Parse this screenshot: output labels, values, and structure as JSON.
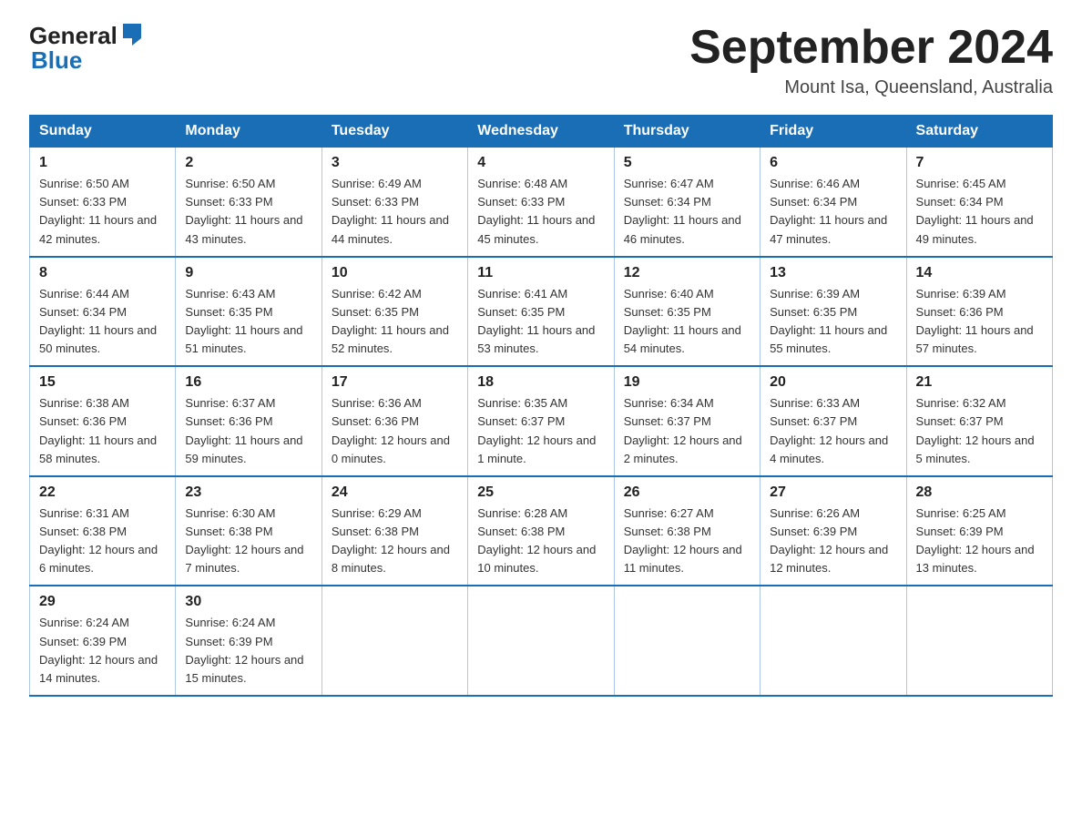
{
  "logo": {
    "general": "General",
    "blue": "Blue"
  },
  "title": "September 2024",
  "subtitle": "Mount Isa, Queensland, Australia",
  "headers": [
    "Sunday",
    "Monday",
    "Tuesday",
    "Wednesday",
    "Thursday",
    "Friday",
    "Saturday"
  ],
  "weeks": [
    [
      {
        "day": "1",
        "sunrise": "6:50 AM",
        "sunset": "6:33 PM",
        "daylight": "11 hours and 42 minutes."
      },
      {
        "day": "2",
        "sunrise": "6:50 AM",
        "sunset": "6:33 PM",
        "daylight": "11 hours and 43 minutes."
      },
      {
        "day": "3",
        "sunrise": "6:49 AM",
        "sunset": "6:33 PM",
        "daylight": "11 hours and 44 minutes."
      },
      {
        "day": "4",
        "sunrise": "6:48 AM",
        "sunset": "6:33 PM",
        "daylight": "11 hours and 45 minutes."
      },
      {
        "day": "5",
        "sunrise": "6:47 AM",
        "sunset": "6:34 PM",
        "daylight": "11 hours and 46 minutes."
      },
      {
        "day": "6",
        "sunrise": "6:46 AM",
        "sunset": "6:34 PM",
        "daylight": "11 hours and 47 minutes."
      },
      {
        "day": "7",
        "sunrise": "6:45 AM",
        "sunset": "6:34 PM",
        "daylight": "11 hours and 49 minutes."
      }
    ],
    [
      {
        "day": "8",
        "sunrise": "6:44 AM",
        "sunset": "6:34 PM",
        "daylight": "11 hours and 50 minutes."
      },
      {
        "day": "9",
        "sunrise": "6:43 AM",
        "sunset": "6:35 PM",
        "daylight": "11 hours and 51 minutes."
      },
      {
        "day": "10",
        "sunrise": "6:42 AM",
        "sunset": "6:35 PM",
        "daylight": "11 hours and 52 minutes."
      },
      {
        "day": "11",
        "sunrise": "6:41 AM",
        "sunset": "6:35 PM",
        "daylight": "11 hours and 53 minutes."
      },
      {
        "day": "12",
        "sunrise": "6:40 AM",
        "sunset": "6:35 PM",
        "daylight": "11 hours and 54 minutes."
      },
      {
        "day": "13",
        "sunrise": "6:39 AM",
        "sunset": "6:35 PM",
        "daylight": "11 hours and 55 minutes."
      },
      {
        "day": "14",
        "sunrise": "6:39 AM",
        "sunset": "6:36 PM",
        "daylight": "11 hours and 57 minutes."
      }
    ],
    [
      {
        "day": "15",
        "sunrise": "6:38 AM",
        "sunset": "6:36 PM",
        "daylight": "11 hours and 58 minutes."
      },
      {
        "day": "16",
        "sunrise": "6:37 AM",
        "sunset": "6:36 PM",
        "daylight": "11 hours and 59 minutes."
      },
      {
        "day": "17",
        "sunrise": "6:36 AM",
        "sunset": "6:36 PM",
        "daylight": "12 hours and 0 minutes."
      },
      {
        "day": "18",
        "sunrise": "6:35 AM",
        "sunset": "6:37 PM",
        "daylight": "12 hours and 1 minute."
      },
      {
        "day": "19",
        "sunrise": "6:34 AM",
        "sunset": "6:37 PM",
        "daylight": "12 hours and 2 minutes."
      },
      {
        "day": "20",
        "sunrise": "6:33 AM",
        "sunset": "6:37 PM",
        "daylight": "12 hours and 4 minutes."
      },
      {
        "day": "21",
        "sunrise": "6:32 AM",
        "sunset": "6:37 PM",
        "daylight": "12 hours and 5 minutes."
      }
    ],
    [
      {
        "day": "22",
        "sunrise": "6:31 AM",
        "sunset": "6:38 PM",
        "daylight": "12 hours and 6 minutes."
      },
      {
        "day": "23",
        "sunrise": "6:30 AM",
        "sunset": "6:38 PM",
        "daylight": "12 hours and 7 minutes."
      },
      {
        "day": "24",
        "sunrise": "6:29 AM",
        "sunset": "6:38 PM",
        "daylight": "12 hours and 8 minutes."
      },
      {
        "day": "25",
        "sunrise": "6:28 AM",
        "sunset": "6:38 PM",
        "daylight": "12 hours and 10 minutes."
      },
      {
        "day": "26",
        "sunrise": "6:27 AM",
        "sunset": "6:38 PM",
        "daylight": "12 hours and 11 minutes."
      },
      {
        "day": "27",
        "sunrise": "6:26 AM",
        "sunset": "6:39 PM",
        "daylight": "12 hours and 12 minutes."
      },
      {
        "day": "28",
        "sunrise": "6:25 AM",
        "sunset": "6:39 PM",
        "daylight": "12 hours and 13 minutes."
      }
    ],
    [
      {
        "day": "29",
        "sunrise": "6:24 AM",
        "sunset": "6:39 PM",
        "daylight": "12 hours and 14 minutes."
      },
      {
        "day": "30",
        "sunrise": "6:24 AM",
        "sunset": "6:39 PM",
        "daylight": "12 hours and 15 minutes."
      },
      null,
      null,
      null,
      null,
      null
    ]
  ]
}
